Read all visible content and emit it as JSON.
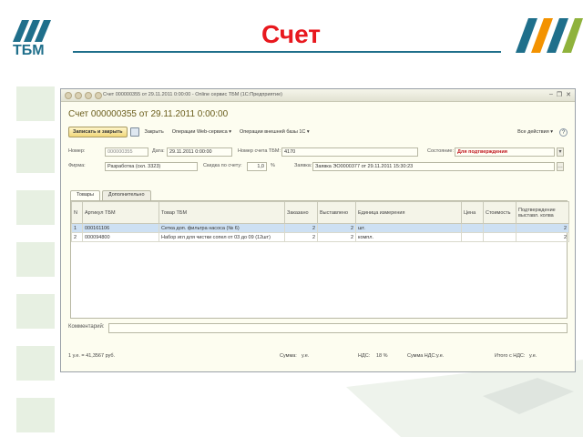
{
  "slide": {
    "title": "Счет",
    "logo_text": "ТБМ"
  },
  "window": {
    "title": "Счет 000000355 от 29.11.2011 0:00:00 - Online сервис ТБМ (1С:Предприятие)",
    "doc_title": "Счет 000000355 от 29.11.2011 0:00:00"
  },
  "toolbar": {
    "save_close": "Записать и закрыть",
    "close": "Закрыть",
    "web_ops": "Операции Web-сервиса ▾",
    "ext_ops": "Операции внешней базы 1С ▾",
    "all_actions": "Все действия ▾",
    "help": "?"
  },
  "fields": {
    "number_label": "Номер:",
    "number_value": "000000355",
    "date_label": "Дата:",
    "date_value": "29.11.2011 0:00:00",
    "tbm_number_label": "Номер счета ТБМ:",
    "tbm_number_value": "4170",
    "state_label": "Состояние:",
    "state_value": "Для подтверждения",
    "firm_label": "Фирма:",
    "firm_value": "Разработка (скл. 3323)",
    "discount_label": "Скидка по счету:",
    "discount_value": "1,0",
    "discount_unit": "%",
    "order_label": "Заявка:",
    "order_value": "Заявка ЭО0000377 от 29.11.2011 15:30:23"
  },
  "tabs": [
    {
      "label": "Товары"
    },
    {
      "label": "Дополнительно"
    }
  ],
  "grid": {
    "columns": [
      "N",
      "Артикул ТБМ",
      "Товар ТБМ",
      "Заказано",
      "Выставлено",
      "Единица измерения",
      "Цена",
      "Стоимость",
      "Подтверждение выставл. колва"
    ],
    "rows": [
      {
        "n": "1",
        "article": "000161106",
        "name": "Сетка доп. фильтра насоса (№ 6)",
        "ordered": "2",
        "issued": "2",
        "unit": "шт.",
        "price": "",
        "cost": "",
        "confirm": "2"
      },
      {
        "n": "2",
        "article": "000094800",
        "name": "Набор игл для чистки сопел от 03 до 09 (12шт)",
        "ordered": "2",
        "issued": "2",
        "unit": "компл.",
        "price": "",
        "cost": "",
        "confirm": "2"
      }
    ]
  },
  "comment_label": "Комментарий:",
  "footer": {
    "rate": "1 у.е. = 41,3567 руб.",
    "sum_label": "Сумма:",
    "sum_unit": "у.е.",
    "vat_label": "НДС:",
    "vat_value": "18 %",
    "vat_sum_label": "Сумма НДС:",
    "vat_sum_unit": "у.е.",
    "total_label": "Итого с НДС:",
    "total_unit": "у.е."
  },
  "colors": {
    "title_red": "#e8181e",
    "brand_teal": "#1f6f8b",
    "brand_orange": "#f39200"
  }
}
